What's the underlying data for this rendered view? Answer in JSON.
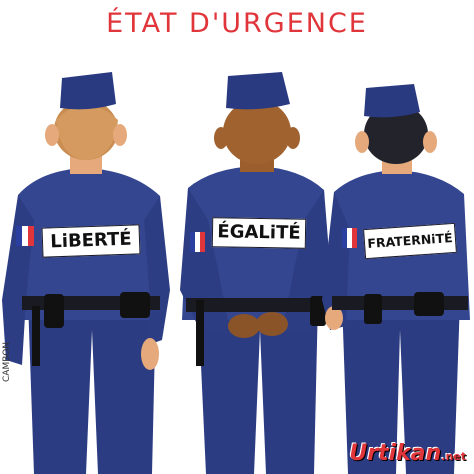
{
  "title": "ÉTAT D'URGENCE",
  "labels": {
    "left": "LiBERTÉ",
    "center": "ÉGALiTÉ",
    "right": "FRATERNiTÉ"
  },
  "signature": "CAMBON",
  "watermark": {
    "name": "Urtikan",
    "suffix": ".net"
  },
  "colors": {
    "uniform": "#2f3f88",
    "uniform_dark": "#1d2a63",
    "skin_light": "#e5a97b",
    "skin_dark": "#a0622f",
    "title_red": "#e0353a"
  }
}
